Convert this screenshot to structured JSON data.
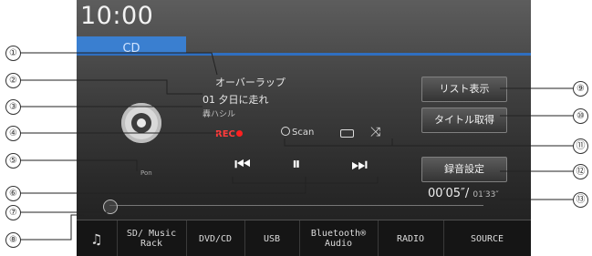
{
  "clock": "10:00",
  "source_tab": "CD",
  "track": {
    "title": "オーバーラップ",
    "name": "01 夕日に走れ",
    "artist": "轟ハシル"
  },
  "rec_label": "REC",
  "pon_label": "Pon",
  "playback": {
    "scan_label": "Scan",
    "prev_icon": "⏮",
    "pause_icon": "⏸",
    "next_icon": "⏭",
    "repeat_icon": "repeat-icon",
    "shuffle_icon": "⤨",
    "progress": 0.0
  },
  "buttons": {
    "list": "リスト表示",
    "title_fetch": "タイトル取得",
    "rec_settings": "録音設定"
  },
  "time": {
    "elapsed": "00′05″/",
    "total": "01′33″"
  },
  "bottom_bar": {
    "menu_icon": "♫",
    "items": [
      "SD/ Music Rack",
      "DVD/CD",
      "USB",
      "Bluetooth® Audio",
      "RADIO",
      "SOURCE"
    ]
  },
  "callouts": [
    "①",
    "②",
    "③",
    "④",
    "⑤",
    "⑥",
    "⑦",
    "⑧",
    "⑨",
    "⑩",
    "⑪",
    "⑫",
    "⑬"
  ],
  "colors": {
    "accent": "#3a7fd0",
    "rec": "#ff2020"
  }
}
